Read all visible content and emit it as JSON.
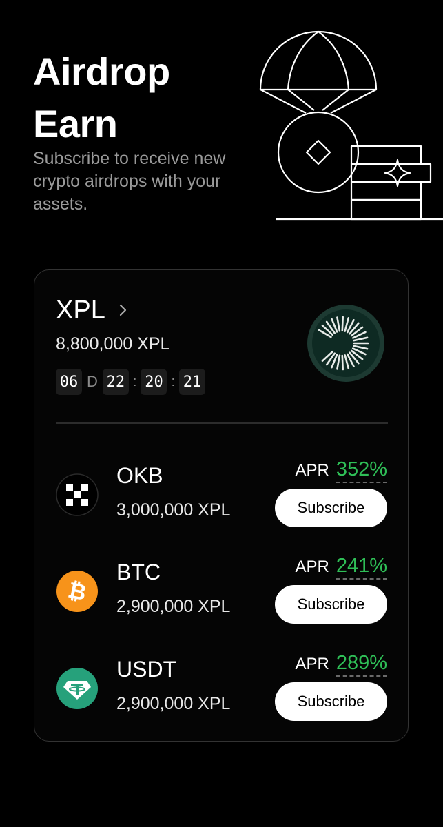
{
  "header": {
    "title_line1": "Airdrop",
    "title_line2": "Earn",
    "subtitle": "Subscribe to receive new crypto airdrops with your assets.",
    "illustration_icon": "parachute-coin-illustration"
  },
  "featured": {
    "name": "XPL",
    "amount": "8,800,000 XPL",
    "countdown": {
      "days": "06",
      "day_unit": "D",
      "hours": "22",
      "minutes": "20",
      "seconds": "21",
      "separator": ":"
    },
    "logo_icon": "plasma-logo-icon"
  },
  "assets": [
    {
      "name": "OKB",
      "amount": "3,000,000 XPL",
      "apr_label": "APR",
      "apr_value": "352%",
      "button_label": "Subscribe",
      "icon": "okb-icon"
    },
    {
      "name": "BTC",
      "amount": "2,900,000 XPL",
      "apr_label": "APR",
      "apr_value": "241%",
      "button_label": "Subscribe",
      "icon": "btc-icon"
    },
    {
      "name": "USDT",
      "amount": "2,900,000 XPL",
      "apr_label": "APR",
      "apr_value": "289%",
      "button_label": "Subscribe",
      "icon": "usdt-icon"
    }
  ],
  "colors": {
    "background": "#000000",
    "apr_green": "#2fbf57",
    "btc_orange": "#f7931a",
    "usdt_teal": "#26a17b"
  }
}
